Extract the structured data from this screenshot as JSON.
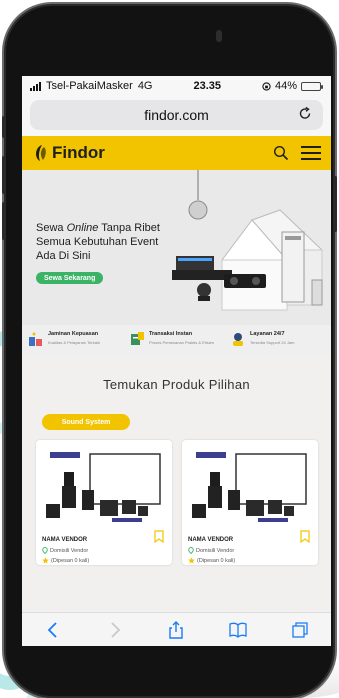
{
  "status": {
    "carrier": "Tsel-PakaiMasker",
    "network": "4G",
    "time": "23.35",
    "battery_label": "44%",
    "battery_level": 0.44
  },
  "browser": {
    "url": "findor.com"
  },
  "brand": {
    "name": "Findor",
    "accent": "#f2c400"
  },
  "hero": {
    "line1_prefix": "Sewa ",
    "line1_em": "Online",
    "line1_suffix": " Tanpa Ribet",
    "line2": "Semua Kebutuhan Event",
    "line3": "Ada Di Sini",
    "cta": "Sewa Sekarang"
  },
  "features": [
    {
      "title": "Jaminan Kepuasan",
      "sub": "Kualitas & Pelayanan Terbaik",
      "icon": "satisfaction-icon"
    },
    {
      "title": "Transaksi Instan",
      "sub": "Proses Pemesanan Praktis & Efisien",
      "icon": "instant-transaction-icon"
    },
    {
      "title": "Layanan 24/7",
      "sub": "Tersedia Support 24 Jam",
      "icon": "support-24-7-icon"
    }
  ],
  "section_title": "Temukan Produk Pilihan",
  "category": "Sound System",
  "products": [
    {
      "vendor": "NAMA VENDOR",
      "location": "Domisili Vendor",
      "orders": "(Dipesan 0 kali)"
    },
    {
      "vendor": "NAMA VENDOR",
      "location": "Domisili Vendor",
      "orders": "(Dipesan 0 kali)"
    }
  ]
}
